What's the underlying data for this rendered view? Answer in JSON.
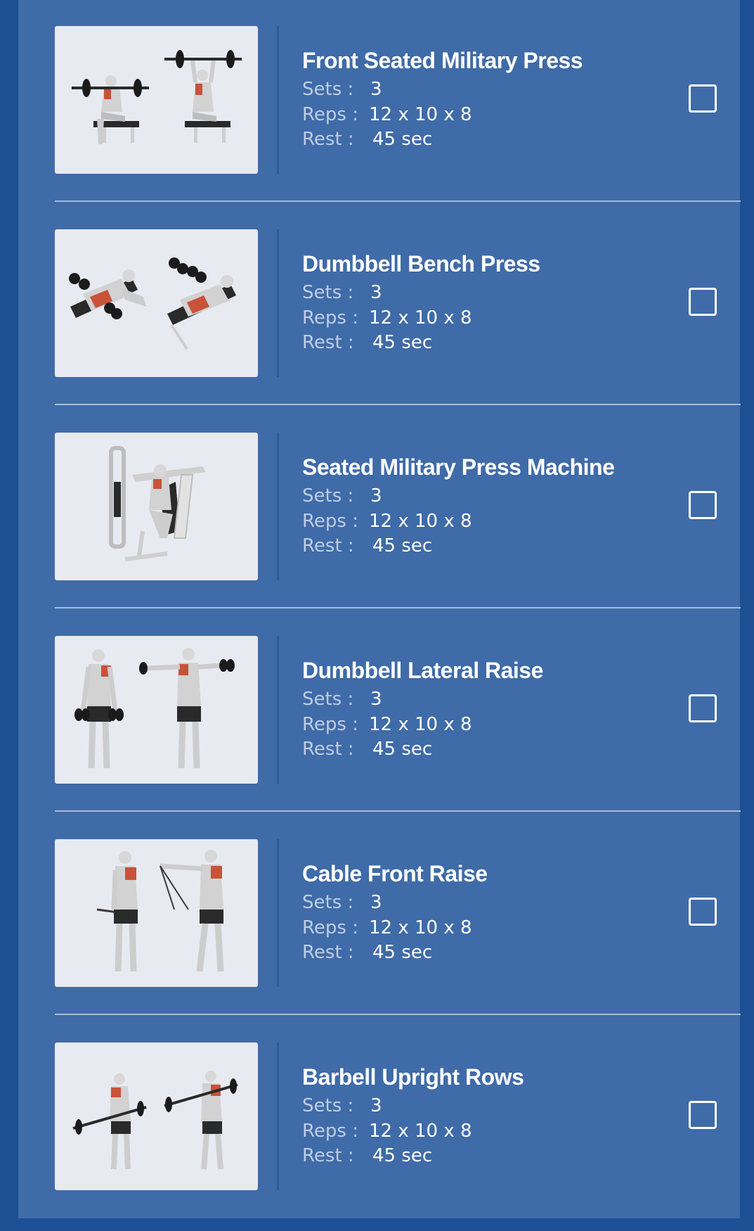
{
  "labels": {
    "sets": "Sets :",
    "reps": "Reps :",
    "rest": "Rest :"
  },
  "exercises": [
    {
      "name": "Front Seated Military Press",
      "sets": "3",
      "reps": "12 x 10 x 8",
      "rest": "45 sec",
      "image_icon": "seated-barbell-press-illustration",
      "checked": false
    },
    {
      "name": "Dumbbell Bench Press",
      "sets": "3",
      "reps": "12 x 10 x 8",
      "rest": "45 sec",
      "image_icon": "dumbbell-bench-press-illustration",
      "checked": false
    },
    {
      "name": "Seated Military Press Machine",
      "sets": "3",
      "reps": "12 x 10 x 8",
      "rest": "45 sec",
      "image_icon": "press-machine-illustration",
      "checked": false
    },
    {
      "name": "Dumbbell Lateral Raise",
      "sets": "3",
      "reps": "12 x 10 x 8",
      "rest": "45 sec",
      "image_icon": "lateral-raise-illustration",
      "checked": false
    },
    {
      "name": "Cable Front Raise",
      "sets": "3",
      "reps": "12 x 10 x 8",
      "rest": "45 sec",
      "image_icon": "cable-front-raise-illustration",
      "checked": false
    },
    {
      "name": "Barbell Upright Rows",
      "sets": "3",
      "reps": "12 x 10 x 8",
      "rest": "45 sec",
      "image_icon": "upright-row-illustration",
      "checked": false
    }
  ],
  "colors": {
    "background": "#1d4f95",
    "panel": "#3f6ba8",
    "thumb_bg": "#e8eaf1",
    "muscle_highlight": "#c8523a"
  }
}
